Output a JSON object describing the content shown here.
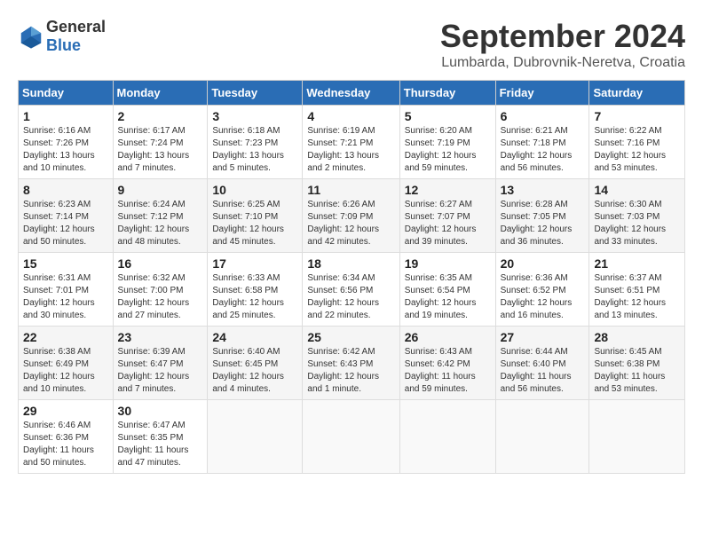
{
  "header": {
    "logo_general": "General",
    "logo_blue": "Blue",
    "month_year": "September 2024",
    "location": "Lumbarda, Dubrovnik-Neretva, Croatia"
  },
  "calendar": {
    "days_of_week": [
      "Sunday",
      "Monday",
      "Tuesday",
      "Wednesday",
      "Thursday",
      "Friday",
      "Saturday"
    ],
    "weeks": [
      [
        {
          "day": "",
          "info": ""
        },
        {
          "day": "2",
          "info": "Sunrise: 6:17 AM\nSunset: 7:24 PM\nDaylight: 13 hours and 7 minutes."
        },
        {
          "day": "3",
          "info": "Sunrise: 6:18 AM\nSunset: 7:23 PM\nDaylight: 13 hours and 5 minutes."
        },
        {
          "day": "4",
          "info": "Sunrise: 6:19 AM\nSunset: 7:21 PM\nDaylight: 13 hours and 2 minutes."
        },
        {
          "day": "5",
          "info": "Sunrise: 6:20 AM\nSunset: 7:19 PM\nDaylight: 12 hours and 59 minutes."
        },
        {
          "day": "6",
          "info": "Sunrise: 6:21 AM\nSunset: 7:18 PM\nDaylight: 12 hours and 56 minutes."
        },
        {
          "day": "7",
          "info": "Sunrise: 6:22 AM\nSunset: 7:16 PM\nDaylight: 12 hours and 53 minutes."
        }
      ],
      [
        {
          "day": "1",
          "info": "Sunrise: 6:16 AM\nSunset: 7:26 PM\nDaylight: 13 hours and 10 minutes."
        },
        {
          "day": "8",
          "info": ""
        },
        {
          "day": "9",
          "info": ""
        },
        {
          "day": "10",
          "info": ""
        },
        {
          "day": "11",
          "info": ""
        },
        {
          "day": "12",
          "info": ""
        },
        {
          "day": "13",
          "info": ""
        }
      ],
      [
        {
          "day": "8",
          "info": "Sunrise: 6:23 AM\nSunset: 7:14 PM\nDaylight: 12 hours and 50 minutes."
        },
        {
          "day": "9",
          "info": "Sunrise: 6:24 AM\nSunset: 7:12 PM\nDaylight: 12 hours and 48 minutes."
        },
        {
          "day": "10",
          "info": "Sunrise: 6:25 AM\nSunset: 7:10 PM\nDaylight: 12 hours and 45 minutes."
        },
        {
          "day": "11",
          "info": "Sunrise: 6:26 AM\nSunset: 7:09 PM\nDaylight: 12 hours and 42 minutes."
        },
        {
          "day": "12",
          "info": "Sunrise: 6:27 AM\nSunset: 7:07 PM\nDaylight: 12 hours and 39 minutes."
        },
        {
          "day": "13",
          "info": "Sunrise: 6:28 AM\nSunset: 7:05 PM\nDaylight: 12 hours and 36 minutes."
        },
        {
          "day": "14",
          "info": "Sunrise: 6:30 AM\nSunset: 7:03 PM\nDaylight: 12 hours and 33 minutes."
        }
      ],
      [
        {
          "day": "15",
          "info": "Sunrise: 6:31 AM\nSunset: 7:01 PM\nDaylight: 12 hours and 30 minutes."
        },
        {
          "day": "16",
          "info": "Sunrise: 6:32 AM\nSunset: 7:00 PM\nDaylight: 12 hours and 27 minutes."
        },
        {
          "day": "17",
          "info": "Sunrise: 6:33 AM\nSunset: 6:58 PM\nDaylight: 12 hours and 25 minutes."
        },
        {
          "day": "18",
          "info": "Sunrise: 6:34 AM\nSunset: 6:56 PM\nDaylight: 12 hours and 22 minutes."
        },
        {
          "day": "19",
          "info": "Sunrise: 6:35 AM\nSunset: 6:54 PM\nDaylight: 12 hours and 19 minutes."
        },
        {
          "day": "20",
          "info": "Sunrise: 6:36 AM\nSunset: 6:52 PM\nDaylight: 12 hours and 16 minutes."
        },
        {
          "day": "21",
          "info": "Sunrise: 6:37 AM\nSunset: 6:51 PM\nDaylight: 12 hours and 13 minutes."
        }
      ],
      [
        {
          "day": "22",
          "info": "Sunrise: 6:38 AM\nSunset: 6:49 PM\nDaylight: 12 hours and 10 minutes."
        },
        {
          "day": "23",
          "info": "Sunrise: 6:39 AM\nSunset: 6:47 PM\nDaylight: 12 hours and 7 minutes."
        },
        {
          "day": "24",
          "info": "Sunrise: 6:40 AM\nSunset: 6:45 PM\nDaylight: 12 hours and 4 minutes."
        },
        {
          "day": "25",
          "info": "Sunrise: 6:42 AM\nSunset: 6:43 PM\nDaylight: 12 hours and 1 minute."
        },
        {
          "day": "26",
          "info": "Sunrise: 6:43 AM\nSunset: 6:42 PM\nDaylight: 11 hours and 59 minutes."
        },
        {
          "day": "27",
          "info": "Sunrise: 6:44 AM\nSunset: 6:40 PM\nDaylight: 11 hours and 56 minutes."
        },
        {
          "day": "28",
          "info": "Sunrise: 6:45 AM\nSunset: 6:38 PM\nDaylight: 11 hours and 53 minutes."
        }
      ],
      [
        {
          "day": "29",
          "info": "Sunrise: 6:46 AM\nSunset: 6:36 PM\nDaylight: 11 hours and 50 minutes."
        },
        {
          "day": "30",
          "info": "Sunrise: 6:47 AM\nSunset: 6:35 PM\nDaylight: 11 hours and 47 minutes."
        },
        {
          "day": "",
          "info": ""
        },
        {
          "day": "",
          "info": ""
        },
        {
          "day": "",
          "info": ""
        },
        {
          "day": "",
          "info": ""
        },
        {
          "day": "",
          "info": ""
        }
      ]
    ]
  }
}
